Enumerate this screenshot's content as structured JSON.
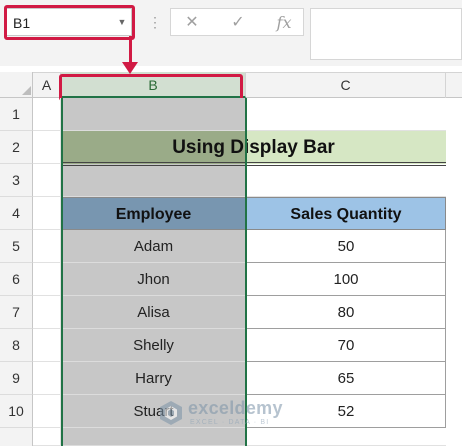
{
  "name_box": {
    "value": "B1"
  },
  "formula_bar": {
    "icons": [
      "vertical-dots-icon",
      "cancel-x-icon",
      "enter-check-icon",
      "fx-icon"
    ],
    "cancel_glyph": "✕",
    "enter_glyph": "✓",
    "fx_glyph": "fx",
    "value": ""
  },
  "columns": [
    "A",
    "B",
    "C"
  ],
  "rows": [
    "1",
    "2",
    "3",
    "4",
    "5",
    "6",
    "7",
    "8",
    "9",
    "10"
  ],
  "selected_column": "B",
  "table": {
    "title": "Using Display Bar",
    "headers": [
      "Employee",
      "Sales Quantity"
    ],
    "rows": [
      [
        "Adam",
        "50"
      ],
      [
        "Jhon",
        "100"
      ],
      [
        "Alisa",
        "80"
      ],
      [
        "Shelly",
        "70"
      ],
      [
        "Harry",
        "65"
      ],
      [
        "Stuart",
        "52"
      ]
    ]
  },
  "watermark": {
    "name": "exceldemy",
    "tagline": "EXCEL · DATA · BI"
  },
  "colors": {
    "highlight": "#d11a44",
    "selection": "#217346",
    "title_fill": "#d6e7c4",
    "header_fill": "#9dc3e6"
  }
}
